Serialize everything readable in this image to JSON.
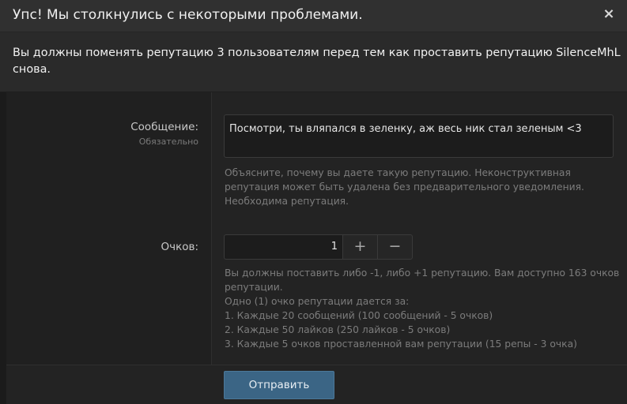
{
  "overlay": {
    "title": "Упс! Мы столкнулись с некоторыми проблемами.",
    "close_icon": "×"
  },
  "error": {
    "message": "Вы должны поменять репутацию 3 пользователям перед тем как проставить репутацию SilenceMhL снова."
  },
  "form": {
    "message": {
      "label": "Сообщение:",
      "required": "Обязательно",
      "value": "Посмотри, ты вляпался в зеленку, аж весь ник стал зеленым <3",
      "hint": "Объясните, почему вы даете такую репутацию. Неконструктивная репутация может быть удалена без предварительного уведомления. Необходима репутация."
    },
    "points": {
      "label": "Очков:",
      "value": "1",
      "plus": "+",
      "minus": "−",
      "hint_lines": [
        "Вы должны поставить либо -1, либо +1 репутацию. Вам доступно 163 очков репутации.",
        "Одно (1) очко репутации дается за:",
        "1. Каждые 20 сообщений (100 сообщений - 5 очков)",
        "2. Каждые 50 лайков (250 лайков - 5 очков)",
        "3. Каждые 5 очков проставленной вам репутации (15 репы - 3 очка)"
      ]
    },
    "submit_label": "Отправить"
  }
}
